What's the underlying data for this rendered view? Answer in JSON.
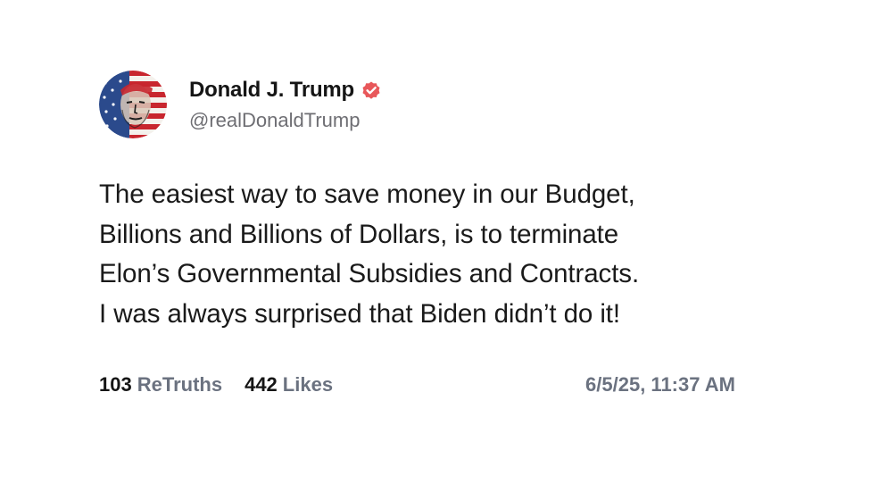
{
  "author": {
    "display_name": "Donald J. Trump",
    "handle": "@realDonaldTrump",
    "verified": true,
    "verified_badge_color": "#e8575a",
    "avatar_icon": "flag-portrait-avatar"
  },
  "post": {
    "lines": [
      "The easiest way to save money in our Budget,",
      "Billions and Billions of Dollars, is to terminate",
      "Elon’s Governmental Subsidies and Contracts.",
      "I was always surprised that Biden didn’t do it!"
    ]
  },
  "stats": {
    "retruths_count": "103",
    "retruths_label": "ReTruths",
    "likes_count": "442",
    "likes_label": "Likes",
    "timestamp": "6/5/25, 11:37 AM"
  }
}
